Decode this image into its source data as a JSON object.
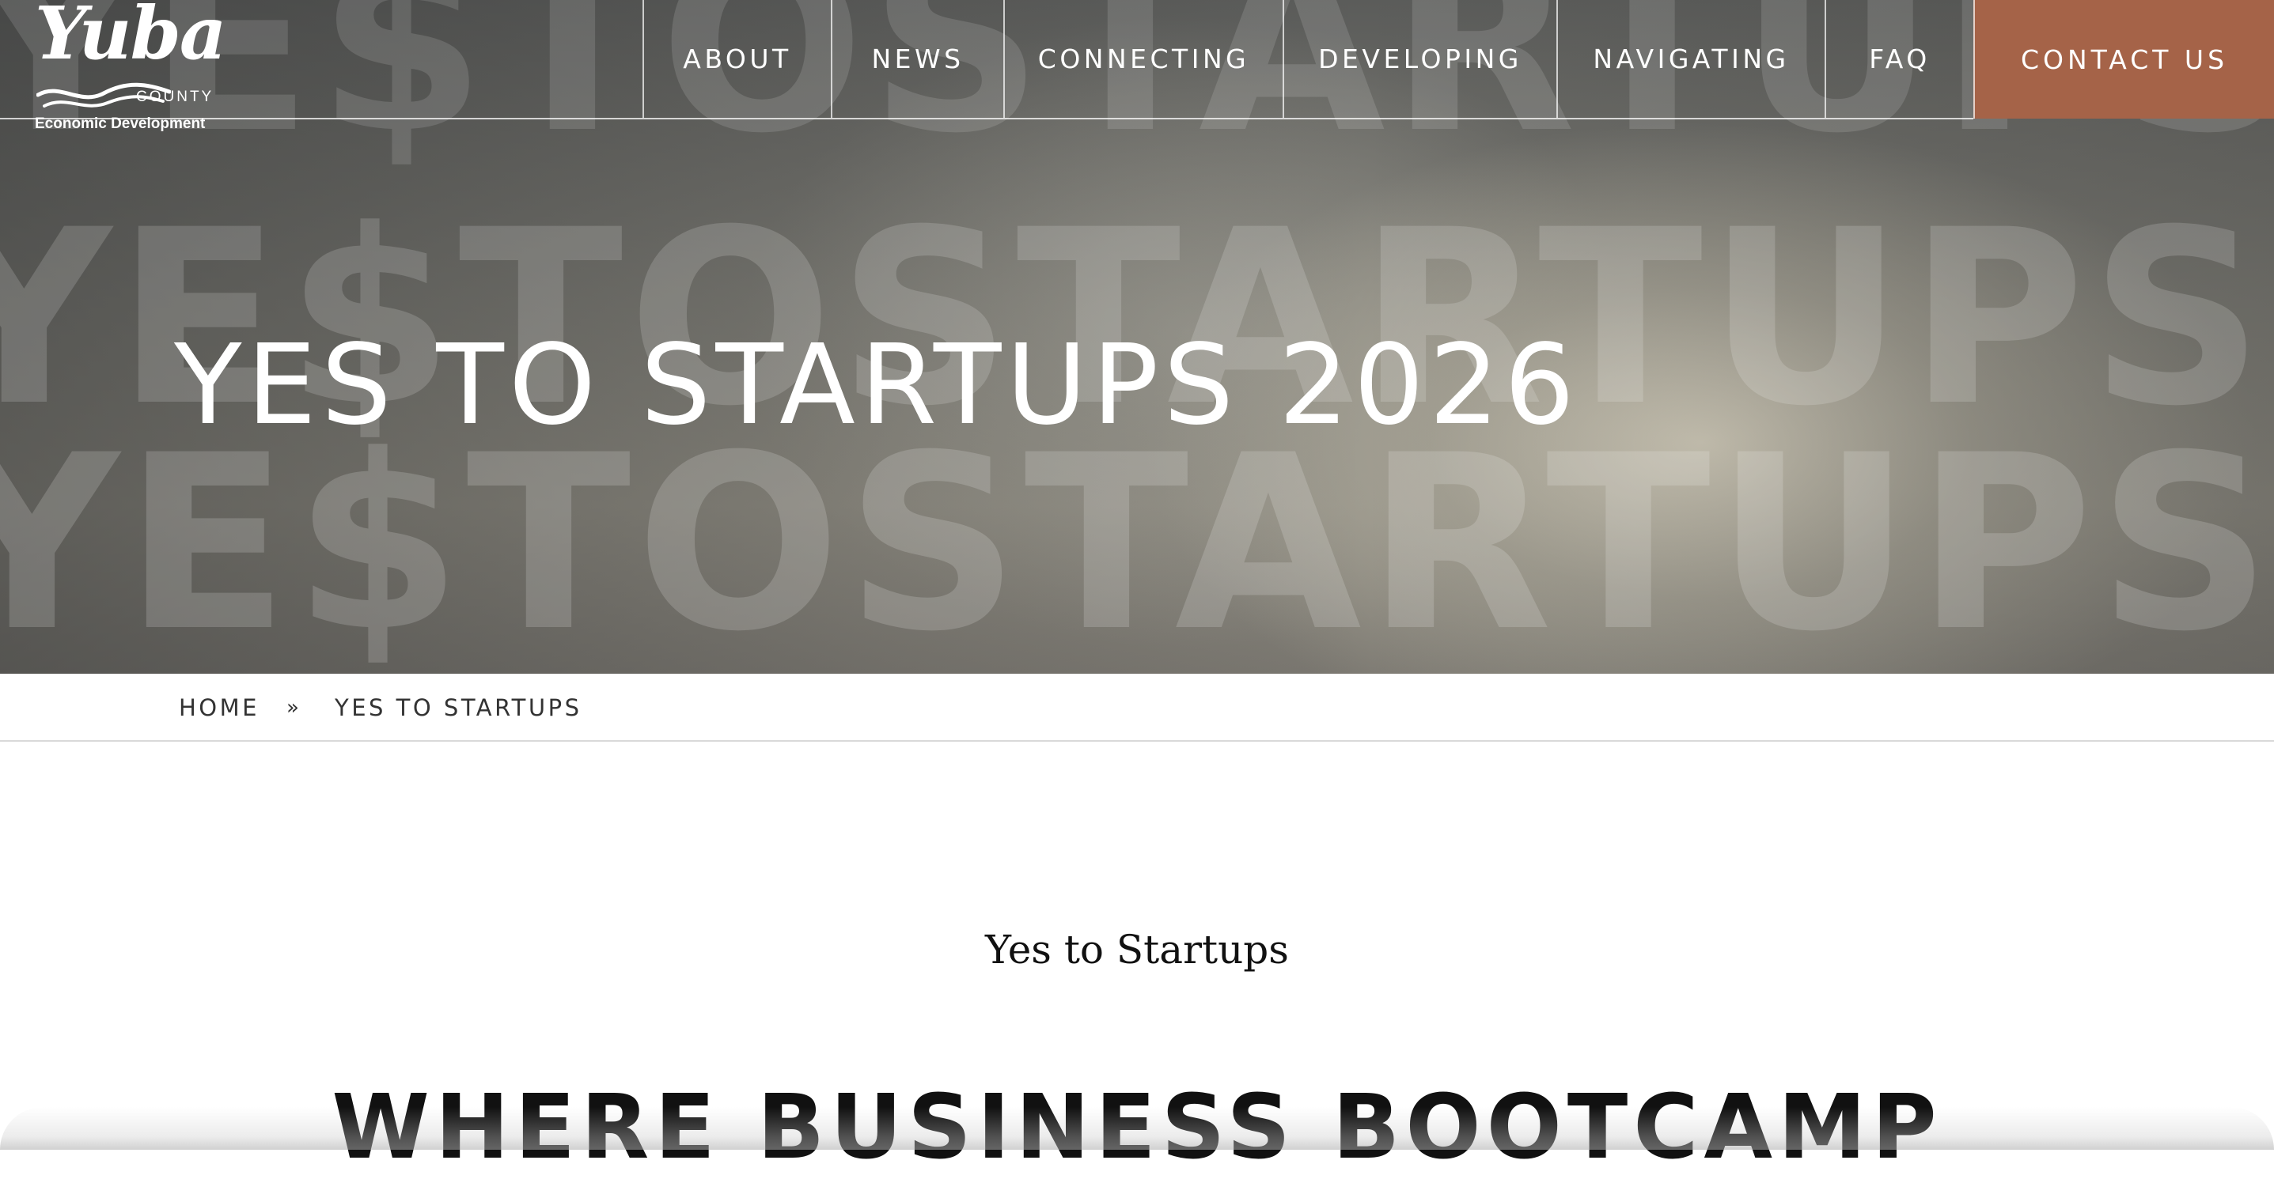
{
  "brand": {
    "logo_script": "Yuba",
    "logo_county": "COUNTY",
    "logo_subtitle": "Economic Development"
  },
  "nav": {
    "items": [
      {
        "label": "ABOUT"
      },
      {
        "label": "NEWS"
      },
      {
        "label": "CONNECTING"
      },
      {
        "label": "DEVELOPING"
      },
      {
        "label": "NAVIGATING"
      },
      {
        "label": "FAQ"
      }
    ],
    "contact_label": "CONTACT US",
    "contact_color": "#a56348"
  },
  "hero": {
    "background_word": "YE$TOSTARTUPS",
    "title": "YES TO STARTUPS 2026"
  },
  "breadcrumb": {
    "home": "HOME",
    "separator": "»",
    "current": "YES TO STARTUPS"
  },
  "content": {
    "eyebrow": "Yes to Startups",
    "headline": "WHERE BUSINESS BOOTCAMP"
  }
}
